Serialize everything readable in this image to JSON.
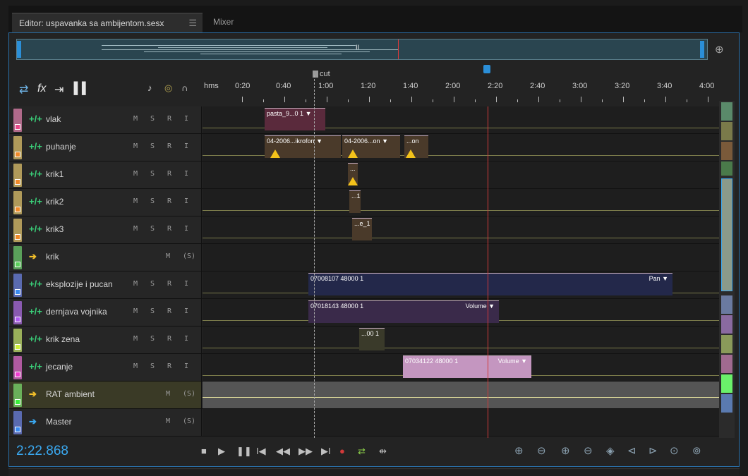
{
  "tabs": [
    {
      "label": "Editor: uspavanka sa ambijentom.sesx",
      "menu": "☰"
    },
    {
      "label": "Mixer"
    }
  ],
  "overview": {
    "zoom_icon": "zoom-to-selection-icon",
    "mid_marker": "II"
  },
  "toolbar": {
    "icons": [
      "multitrack-toggle-icon",
      "fx-icon",
      "sends-icon",
      "eq-icon",
      "metronome-icon",
      "input-monitor-icon",
      "headphones-icon"
    ]
  },
  "ruler": {
    "cut_marker": "cut",
    "labels": [
      "hms",
      "0:20",
      "0:40",
      "1:00",
      "1:20",
      "1:40",
      "2:00",
      "2:20",
      "2:40",
      "3:00",
      "3:20",
      "3:40",
      "4:00"
    ]
  },
  "colors": {
    "accent": "#2b8fd8",
    "playhead": "#d23a3a",
    "warning": "#f3c21a"
  },
  "tracks": [
    {
      "name": "vlak",
      "kind": "wave",
      "strip": "#b06a8a",
      "buttons": [
        "M",
        "S",
        "R",
        "I"
      ],
      "clips": [
        {
          "label": "pasta_9...0 1",
          "menu": "▼",
          "color": "#5a2a3c"
        }
      ]
    },
    {
      "name": "puhanje",
      "kind": "wave",
      "strip": "#b09a5a",
      "buttons": [
        "M",
        "S",
        "R",
        "I"
      ],
      "clips": [
        {
          "label": "04-2006...ikrofon",
          "menu": "▼",
          "color": "#4a3a2a"
        },
        {
          "label": "04-2006...on",
          "menu": "▼",
          "color": "#4a3a2a"
        },
        {
          "label": "...on",
          "menu": "",
          "color": "#4a3a2a"
        }
      ]
    },
    {
      "name": "krik1",
      "kind": "wave",
      "strip": "#b09a5a",
      "buttons": [
        "M",
        "S",
        "R",
        "I"
      ],
      "clips": [
        {
          "label": "...",
          "menu": "",
          "color": "#4a3a2a"
        }
      ]
    },
    {
      "name": "krik2",
      "kind": "wave",
      "strip": "#b09a5a",
      "buttons": [
        "M",
        "S",
        "R",
        "I"
      ],
      "clips": [
        {
          "label": "...1",
          "menu": "",
          "color": "#4a3a2a"
        }
      ]
    },
    {
      "name": "krik3",
      "kind": "wave",
      "strip": "#b09a5a",
      "buttons": [
        "M",
        "S",
        "R",
        "I"
      ],
      "clips": [
        {
          "label": "...e_1",
          "menu": "",
          "color": "#4a3a2a"
        }
      ]
    },
    {
      "name": "krik",
      "kind": "bus",
      "strip": "#5aa05a",
      "buttons": [
        "M",
        "(S)"
      ],
      "clips": []
    },
    {
      "name": "eksplozije i pucan",
      "kind": "wave",
      "strip": "#5a6ab0",
      "buttons": [
        "M",
        "S",
        "R",
        "I"
      ],
      "clips": [
        {
          "label": "07008107 48000 1",
          "menu": "Pan ▼",
          "color": "#23284a"
        }
      ]
    },
    {
      "name": "dernjava vojnika",
      "kind": "wave",
      "strip": "#8a5ab0",
      "buttons": [
        "M",
        "S",
        "R",
        "I"
      ],
      "clips": [
        {
          "label": "07018143 48000 1",
          "menu": "Volume ▼",
          "color": "#3a2a4a"
        }
      ]
    },
    {
      "name": "krik zena",
      "kind": "wave",
      "strip": "#9ab05a",
      "buttons": [
        "M",
        "S",
        "R",
        "I"
      ],
      "clips": [
        {
          "label": "...00 1",
          "menu": "",
          "color": "#3a3a2a"
        }
      ]
    },
    {
      "name": "jecanje",
      "kind": "wave",
      "strip": "#b05aa0",
      "buttons": [
        "M",
        "S",
        "R",
        "I"
      ],
      "clips": [
        {
          "label": "07034122 48000 1",
          "menu": "Volume ▼",
          "color": "#c496c0"
        }
      ]
    },
    {
      "name": "RAT ambient",
      "kind": "bus",
      "strip": "#6ab05a",
      "buttons": [
        "M",
        "(S)"
      ],
      "clips": []
    },
    {
      "name": "Master",
      "kind": "master",
      "strip": "#5a6ab0",
      "buttons": [
        "M",
        "(S)"
      ],
      "clips": []
    }
  ],
  "transport": {
    "timecode": "2:22.868",
    "buttons": [
      "■",
      "▶",
      "❚❚",
      "I◀",
      "◀◀",
      "▶▶",
      "▶I",
      "●",
      "⇄",
      "⇹"
    ]
  },
  "zoom_icons": [
    "zoom-in-amplitude-icon",
    "zoom-out-amplitude-icon",
    "zoom-in-time-icon",
    "zoom-out-time-icon",
    "zoom-to-selection-icon",
    "zoom-in-left-icon",
    "zoom-in-right-icon",
    "zoom-both-icon",
    "zoom-reset-icon"
  ]
}
